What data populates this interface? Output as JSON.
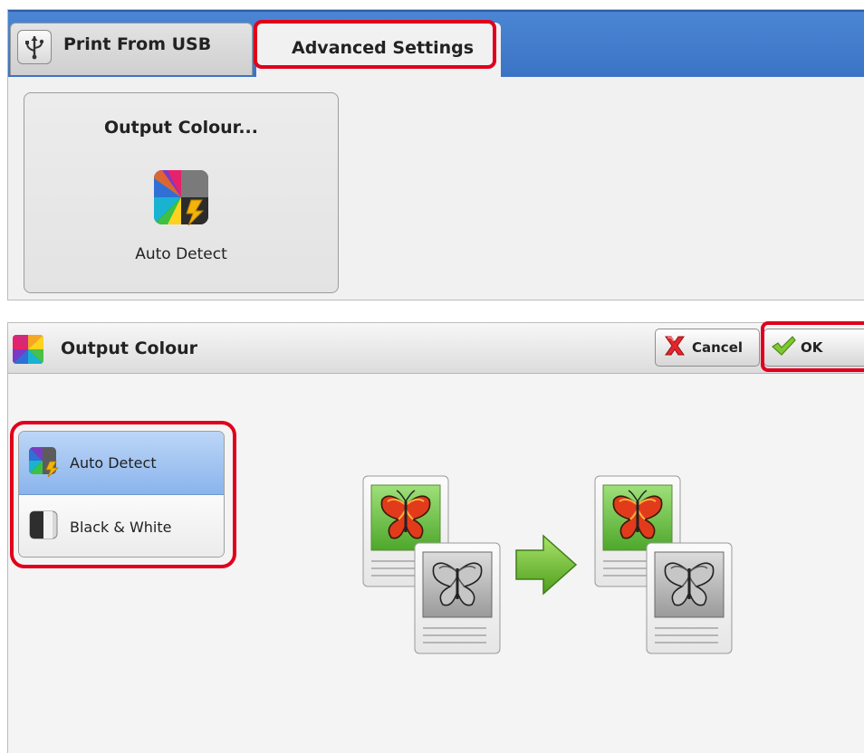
{
  "tabs": [
    {
      "label": "Print From USB",
      "icon": "usb-icon"
    },
    {
      "label": "Advanced Settings"
    }
  ],
  "feature_tile": {
    "title": "Output Colour...",
    "value": "Auto Detect",
    "icon": "auto-detect-colour-icon"
  },
  "dialog": {
    "title": "Output Colour",
    "icon": "output-colour-icon",
    "cancel_label": "Cancel",
    "ok_label": "OK",
    "options": [
      {
        "label": "Auto Detect",
        "icon": "auto-detect-colour-icon",
        "selected": true
      },
      {
        "label": "Black & White",
        "icon": "black-white-icon",
        "selected": false
      }
    ]
  },
  "colors": {
    "highlight": "#e0001b",
    "tab_bar": "#3f79c9",
    "selected_option": "#9fc2f0"
  }
}
